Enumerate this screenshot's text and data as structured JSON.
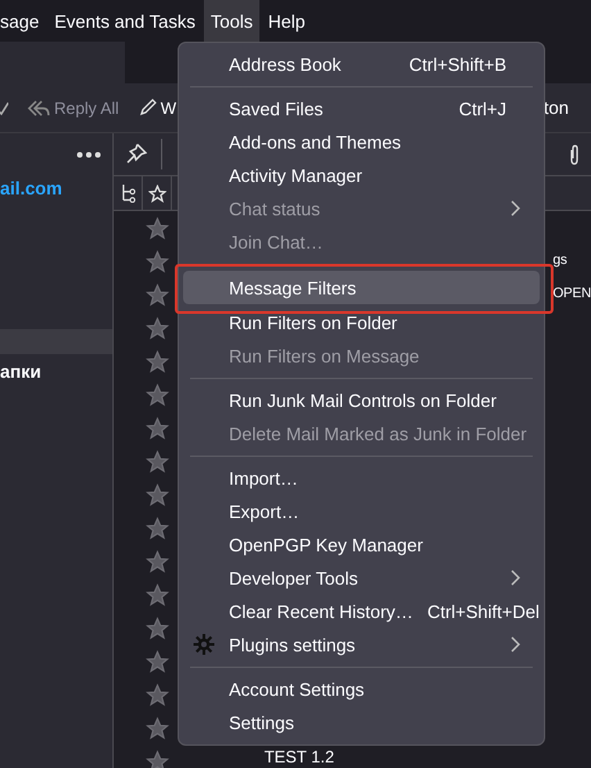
{
  "menubar": [
    {
      "label": "sage",
      "selected": false
    },
    {
      "label": "Events and Tasks",
      "selected": false
    },
    {
      "label": "Tools",
      "selected": true
    },
    {
      "label": "Help",
      "selected": false
    }
  ],
  "toolbar": {
    "reply_all": "Reply All",
    "write": "W",
    "right_text": "ton"
  },
  "folder_pane": {
    "account": "ail.com",
    "folder_label": "апки"
  },
  "message_list": {
    "rows": [
      {
        "starred": false
      },
      {
        "starred": false,
        "subject": "gs",
        "kind": "partial"
      },
      {
        "starred": false,
        "subject": "OPEN",
        "kind": "partial"
      },
      {
        "starred": false
      },
      {
        "starred": false
      },
      {
        "starred": false
      },
      {
        "starred": false
      },
      {
        "starred": false
      },
      {
        "starred": false
      },
      {
        "starred": false
      },
      {
        "starred": false
      },
      {
        "starred": false
      },
      {
        "starred": false
      },
      {
        "starred": false
      },
      {
        "starred": false
      },
      {
        "starred": false
      },
      {
        "starred": false,
        "subject": "TEST 1.2",
        "kind": "plain"
      }
    ]
  },
  "menu": {
    "items": [
      {
        "kind": "item",
        "label": "Address Book",
        "shortcut": "Ctrl+Shift+B",
        "disabled": false,
        "selected": false
      },
      {
        "kind": "separator"
      },
      {
        "kind": "item",
        "label": "Saved Files",
        "shortcut": "Ctrl+J",
        "disabled": false,
        "selected": false
      },
      {
        "kind": "item",
        "label": "Add-ons and Themes",
        "disabled": false,
        "selected": false
      },
      {
        "kind": "item",
        "label": "Activity Manager",
        "disabled": false,
        "selected": false
      },
      {
        "kind": "item",
        "label": "Chat status",
        "disabled": true,
        "submenu": true,
        "selected": false
      },
      {
        "kind": "item",
        "label": "Join Chat…",
        "disabled": true,
        "selected": false
      },
      {
        "kind": "item",
        "label": "Message Filters",
        "disabled": false,
        "selected": true,
        "outlined": true
      },
      {
        "kind": "item",
        "label": "Run Filters on Folder",
        "disabled": false,
        "selected": false
      },
      {
        "kind": "item",
        "label": "Run Filters on Message",
        "disabled": true,
        "selected": false
      },
      {
        "kind": "separator"
      },
      {
        "kind": "item",
        "label": "Run Junk Mail Controls on Folder",
        "disabled": false,
        "selected": false
      },
      {
        "kind": "item",
        "label": "Delete Mail Marked as Junk in Folder",
        "disabled": true,
        "selected": false
      },
      {
        "kind": "separator"
      },
      {
        "kind": "item",
        "label": "Import…",
        "disabled": false,
        "selected": false
      },
      {
        "kind": "item",
        "label": "Export…",
        "disabled": false,
        "selected": false
      },
      {
        "kind": "item",
        "label": "OpenPGP Key Manager",
        "disabled": false,
        "selected": false
      },
      {
        "kind": "item",
        "label": "Developer Tools",
        "disabled": false,
        "submenu": true,
        "selected": false
      },
      {
        "kind": "item",
        "label": "Clear Recent History…",
        "shortcut": "Ctrl+Shift+Del",
        "disabled": false,
        "selected": false
      },
      {
        "kind": "item",
        "label": "Plugins settings",
        "disabled": false,
        "submenu": true,
        "has_icon": true,
        "selected": false
      },
      {
        "kind": "separator"
      },
      {
        "kind": "item",
        "label": "Account Settings",
        "disabled": false,
        "selected": false
      },
      {
        "kind": "item",
        "label": "Settings",
        "disabled": false,
        "selected": false
      }
    ]
  }
}
